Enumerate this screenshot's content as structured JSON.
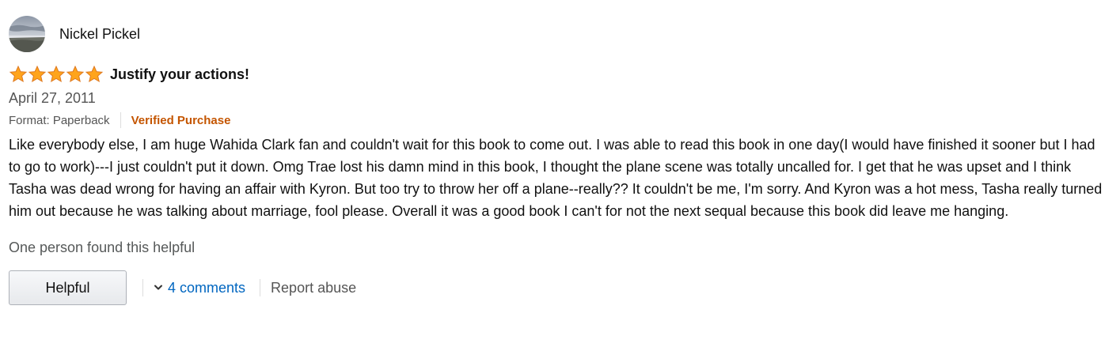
{
  "review": {
    "profile": {
      "name": "Nickel Pickel",
      "avatar_icon": "profile-avatar-landscape"
    },
    "rating": {
      "stars": 5,
      "max_stars": 5,
      "star_color": "#FFA41C"
    },
    "title": "Justify your actions!",
    "date": "April 27, 2011",
    "format": "Format: Paperback",
    "verified_label": "Verified Purchase",
    "verified_color": "#C45500",
    "body": "Like everybody else, I am huge Wahida Clark fan and couldn't wait for this book to come out. I was able to read this book in one day(I would have finished it sooner but I had to go to work)---I just couldn't put it down. Omg Trae lost his damn mind in this book, I thought the plane scene was totally uncalled for. I get that he was upset and I think Tasha was dead wrong for having an affair with Kyron. But too try to throw her off a plane--really?? It couldn't be me, I'm sorry. And Kyron was a hot mess, Tasha really turned him out because he was talking about marriage, fool please. Overall it was a good book I can't for not the next sequal because this book did leave me hanging.",
    "helpful_count_text": "One person found this helpful"
  },
  "actions": {
    "helpful_button": "Helpful",
    "comments_link": "4 comments",
    "comments_icon": "chevron-down-icon",
    "report_link": "Report abuse",
    "link_color": "#0066C0"
  }
}
